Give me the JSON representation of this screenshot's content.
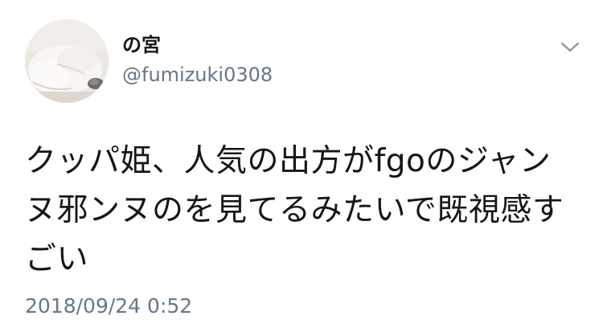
{
  "author": {
    "display_name": "の宮",
    "handle": "@fumizuki0308",
    "avatar_icon": "cat-avatar-icon"
  },
  "menu": {
    "icon": "chevron-down-icon"
  },
  "tweet": {
    "text": "クッパ姫、人気の出方がfgoのジャンヌ邪ンヌのを見てるみたいで既視感すごい",
    "timestamp": "2018/09/24 0:52"
  },
  "colors": {
    "text_primary": "#14171a",
    "text_secondary": "#657786",
    "background": "#ffffff"
  }
}
